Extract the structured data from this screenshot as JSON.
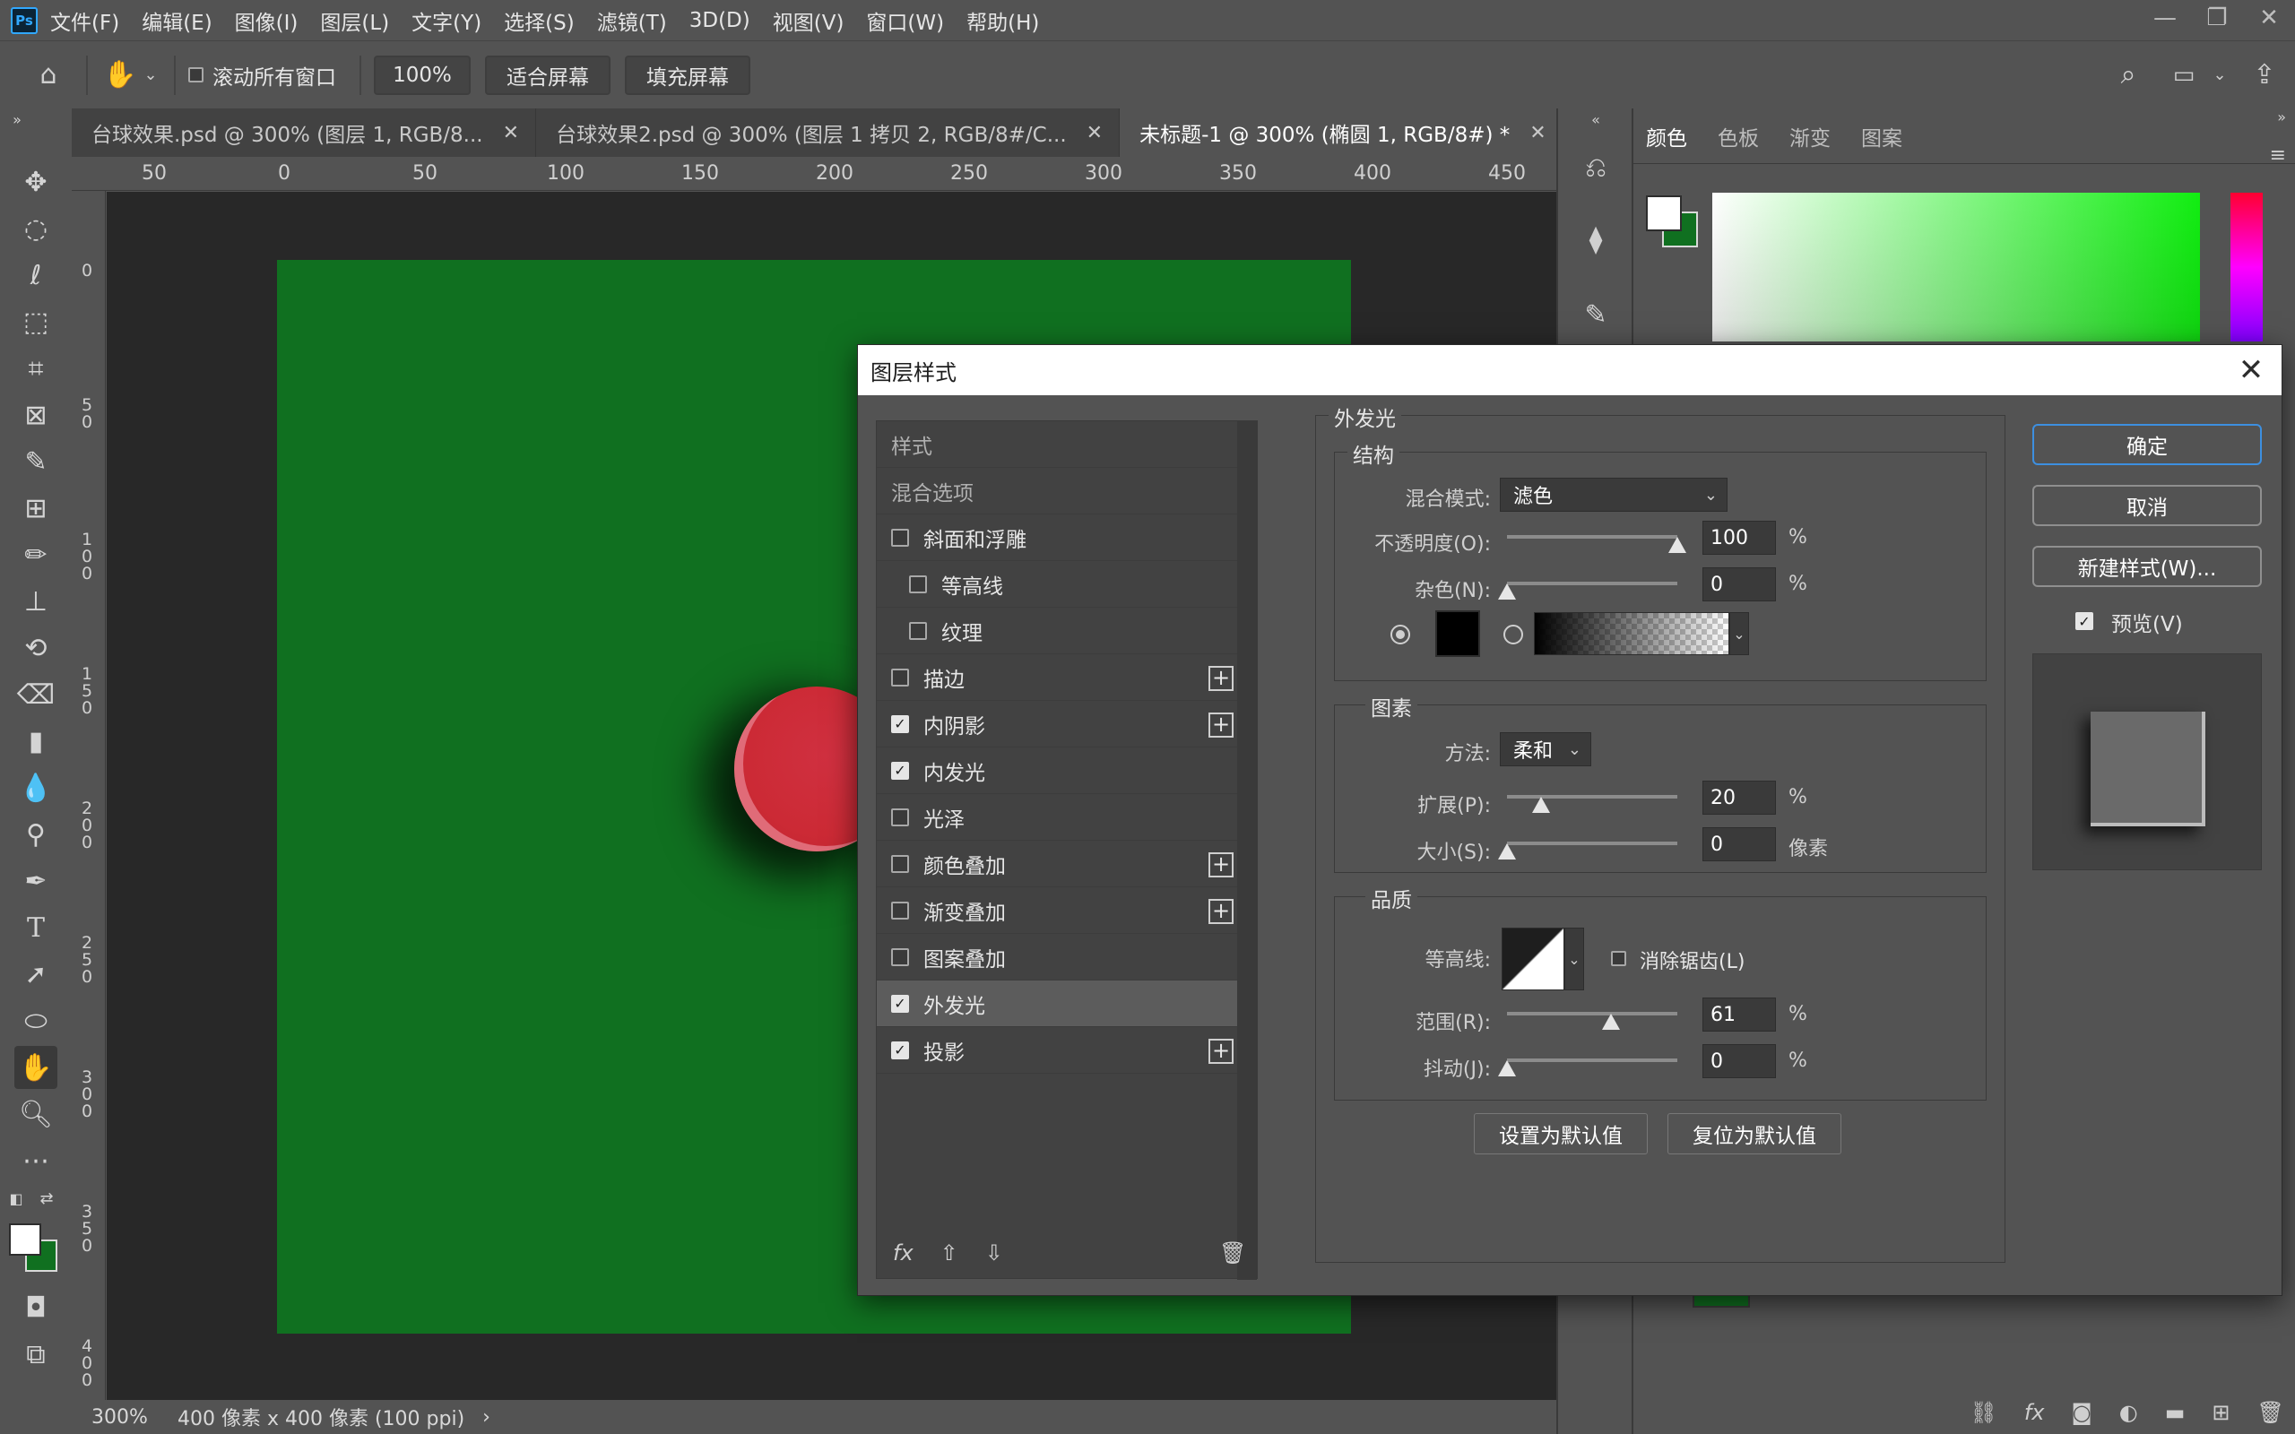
{
  "app": {
    "logo": "Ps"
  },
  "menu": [
    "文件(F)",
    "编辑(E)",
    "图像(I)",
    "图层(L)",
    "文字(Y)",
    "选择(S)",
    "滤镜(T)",
    "3D(D)",
    "视图(V)",
    "窗口(W)",
    "帮助(H)"
  ],
  "options": {
    "scroll_all_label": "滚动所有窗口",
    "zoom_value": "100%",
    "fit_screen": "适合屏幕",
    "fill_screen": "填充屏幕"
  },
  "tabs": [
    {
      "title": "台球效果.psd @ 300% (图层 1, RGB/8..."
    },
    {
      "title": "台球效果2.psd @ 300% (图层 1 拷贝 2, RGB/8#/C..."
    },
    {
      "title": "未标题-1 @ 300% (椭圆 1, RGB/8#) *"
    }
  ],
  "ruler": {
    "top": [
      "50",
      "0",
      "50",
      "100",
      "150",
      "200",
      "250",
      "300",
      "350",
      "400",
      "450"
    ],
    "left": [
      "0",
      "50",
      "100",
      "150",
      "200",
      "250",
      "300",
      "350",
      "400"
    ]
  },
  "status": {
    "zoom": "300%",
    "doc_info": "400 像素 x 400 像素 (100 ppi)",
    "arrow": "›"
  },
  "color_panel": {
    "tabs": [
      "颜色",
      "色板",
      "渐变",
      "图案"
    ],
    "fg_color": "#ffffff",
    "bg_color": "#107020"
  },
  "canvas": {
    "bg_color": "#107020",
    "ball_color": "#cc2a35"
  },
  "dialog": {
    "title": "图层样式",
    "styles_header": "样式",
    "blend_options": "混合选项",
    "items": [
      {
        "label": "斜面和浮雕",
        "checked": false,
        "indent": false,
        "plus": false
      },
      {
        "label": "等高线",
        "checked": false,
        "indent": true,
        "plus": false
      },
      {
        "label": "纹理",
        "checked": false,
        "indent": true,
        "plus": false
      },
      {
        "label": "描边",
        "checked": false,
        "indent": false,
        "plus": true
      },
      {
        "label": "内阴影",
        "checked": true,
        "indent": false,
        "plus": true
      },
      {
        "label": "内发光",
        "checked": true,
        "indent": false,
        "plus": false
      },
      {
        "label": "光泽",
        "checked": false,
        "indent": false,
        "plus": false
      },
      {
        "label": "颜色叠加",
        "checked": false,
        "indent": false,
        "plus": true
      },
      {
        "label": "渐变叠加",
        "checked": false,
        "indent": false,
        "plus": true
      },
      {
        "label": "图案叠加",
        "checked": false,
        "indent": false,
        "plus": false
      },
      {
        "label": "外发光",
        "checked": true,
        "indent": false,
        "plus": false,
        "selected": true
      },
      {
        "label": "投影",
        "checked": true,
        "indent": false,
        "plus": true
      }
    ],
    "footer_fx": "fx",
    "section_title": "外发光",
    "structure": {
      "title": "结构",
      "blend_mode_label": "混合模式:",
      "blend_mode_value": "滤色",
      "opacity_label": "不透明度(O):",
      "opacity_value": "100",
      "opacity_level": 1.0,
      "noise_label": "杂色(N):",
      "noise_value": "0",
      "noise_level": 0.0,
      "percent": "%"
    },
    "elements": {
      "title": "图素",
      "method_label": "方法:",
      "method_value": "柔和",
      "spread_label": "扩展(P):",
      "spread_value": "20",
      "spread_level": 0.2,
      "size_label": "大小(S):",
      "size_value": "0",
      "size_level": 0.0,
      "size_unit": "像素",
      "percent": "%"
    },
    "quality": {
      "title": "品质",
      "contour_label": "等高线:",
      "antialias_label": "消除锯齿(L)",
      "range_label": "范围(R):",
      "range_value": "61",
      "range_level": 0.61,
      "jitter_label": "抖动(J):",
      "jitter_value": "0",
      "jitter_level": 0.0,
      "percent": "%"
    },
    "set_default": "设置为默认值",
    "reset_default": "复位为默认值",
    "ok": "确定",
    "cancel": "取消",
    "new_style": "新建样式(W)...",
    "preview_label": "预览(V)"
  }
}
